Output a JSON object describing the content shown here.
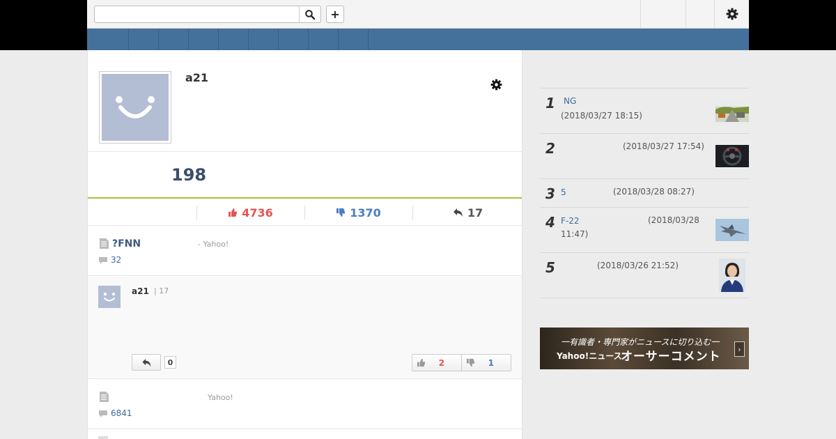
{
  "topbar": {
    "search_placeholder": "",
    "search_icon": "search-icon",
    "plus_label": "+",
    "settings_icon": "gear-icon"
  },
  "nav": {
    "tab_count": 9
  },
  "profile": {
    "username": "a21",
    "points": "198",
    "avatar_color": "#b3bdd4"
  },
  "stats": {
    "likes": "4736",
    "dislikes": "1370",
    "replies": "17",
    "like_color": "#e25555",
    "dislike_color": "#4b7dc2"
  },
  "article1": {
    "title": "?FNN",
    "source": "- Yahoo!",
    "comment_count": "32"
  },
  "comment": {
    "author": "a21",
    "reply_meta": "| 17",
    "reply_count": "0",
    "up_votes": "2",
    "down_votes": "1"
  },
  "article2": {
    "source": "Yahoo!",
    "comment_count": "6841"
  },
  "ranking": [
    {
      "rank": "1",
      "title": "NG",
      "time": "(2018/03/27 18:15)",
      "thumb": "road-accident-photo"
    },
    {
      "rank": "2",
      "title": "",
      "time": "(2018/03/27 17:54)",
      "thumb": "steering-wheel-photo"
    },
    {
      "rank": "3",
      "title": "5",
      "time": "(2018/03/28 08:27)",
      "thumb": ""
    },
    {
      "rank": "4",
      "title": "F-22",
      "time": "(2018/03/28 11:47)",
      "thumb": "fighter-jet-photo"
    },
    {
      "rank": "5",
      "title": "",
      "time": "(2018/03/26 21:52)",
      "thumb": "politician-portrait-photo"
    }
  ],
  "banner": {
    "line1": "一有識者・専門家がニュースに切り込む一",
    "brand": "Yahoo!ニュース",
    "main": "オーサーコメント",
    "arrow": "›"
  }
}
